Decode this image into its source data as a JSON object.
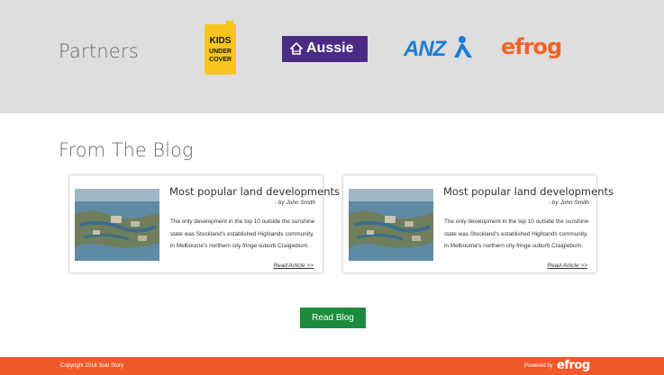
{
  "partners": {
    "title": "Partners",
    "logos": [
      {
        "name": "Kids Under Cover",
        "line1": "KIDS",
        "line2": "UNDER",
        "line3": "COVER",
        "color": "#f7c51d"
      },
      {
        "name": "Aussie",
        "text": "Aussie",
        "color": "#4b2a84"
      },
      {
        "name": "ANZ",
        "text": "ANZ",
        "color": "#1c7dd3"
      },
      {
        "name": "efrog",
        "text": "efrog",
        "color": "#f06427"
      }
    ]
  },
  "blog": {
    "title": "From The Blog",
    "posts": [
      {
        "title": "Most popular land developments",
        "author": "- by John Smith",
        "excerpt": "The only development in the top 10 outside the sunshine state  was Stockland's established Highlands community, in Melbourne's northern city fringe suburb Craigieburn.",
        "link": "Read Article >>"
      },
      {
        "title": "Most popular land developments",
        "author": "- by John Smith",
        "excerpt": "The only development in the top 10 outside the sunshine state  was Stockland's established Highlands community, in Melbourne's northern city fringe suburb Craigieburn.",
        "link": "Read Article >>"
      }
    ],
    "button": "Read Blog"
  },
  "footer": {
    "copyright": "Copyright 2016 Sold Story",
    "powered_by": "Powered by",
    "logo": "efrog"
  },
  "colors": {
    "partners_bg": "#dedede",
    "button": "#1a8c3c",
    "footer": "#f05a2b"
  }
}
